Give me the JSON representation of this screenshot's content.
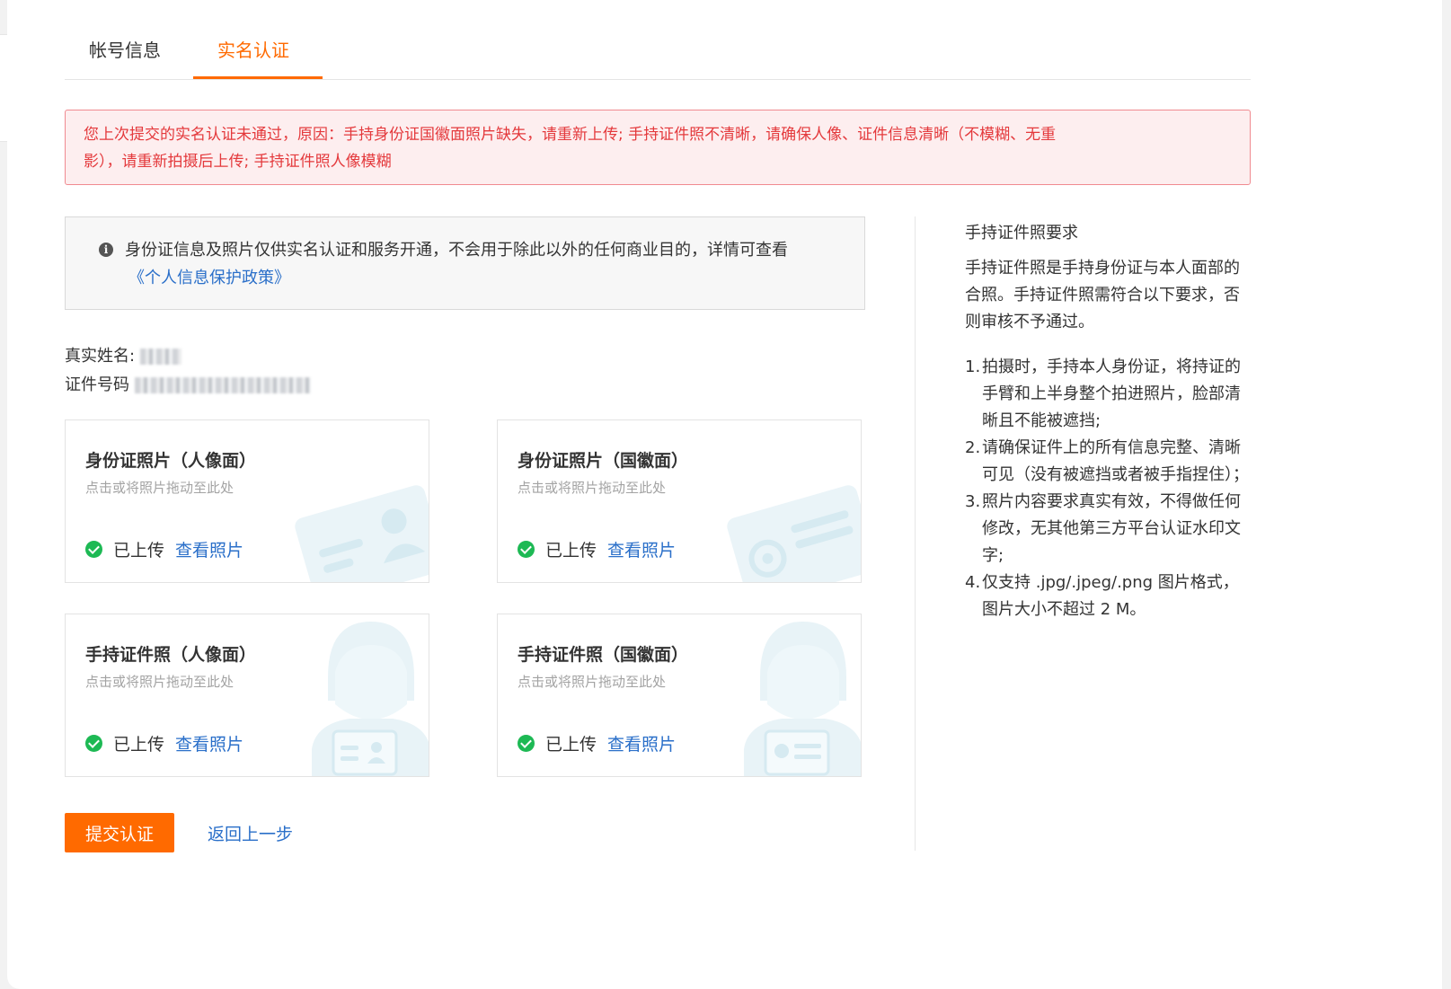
{
  "tabs": [
    {
      "label": "帐号信息",
      "active": false
    },
    {
      "label": "实名认证",
      "active": true
    }
  ],
  "error_banner": {
    "line1": "您上次提交的实名认证未通过，原因：手持身份证国徽面照片缺失，请重新上传; 手持证件照不清晰，请确保人像、证件信息清晰（不模糊、无重",
    "line2": "影），请重新拍摄后上传; 手持证件照人像模糊"
  },
  "info_box": {
    "icon": "info-circle-icon",
    "text": "身份证信息及照片仅供实名认证和服务开通，不会用于除此以外的任何商业目的，详情可查看",
    "link": "《个人信息保护政策》"
  },
  "identity": {
    "name_label": "真实姓名:",
    "id_label": "证件号码"
  },
  "cards": [
    {
      "title": "身份证照片（人像面）",
      "hint": "点击或将照片拖动至此处",
      "status": "已上传",
      "view": "查看照片",
      "illustration": "id-card-portrait-icon"
    },
    {
      "title": "身份证照片（国徽面）",
      "hint": "点击或将照片拖动至此处",
      "status": "已上传",
      "view": "查看照片",
      "illustration": "id-card-emblem-icon"
    },
    {
      "title": "手持证件照（人像面）",
      "hint": "点击或将照片拖动至此处",
      "status": "已上传",
      "view": "查看照片",
      "illustration": "person-holding-id-icon"
    },
    {
      "title": "手持证件照（国徽面）",
      "hint": "点击或将照片拖动至此处",
      "status": "已上传",
      "view": "查看照片",
      "illustration": "person-holding-id-icon"
    }
  ],
  "actions": {
    "submit": "提交认证",
    "back": "返回上一步"
  },
  "requirements": {
    "title": "手持证件照要求",
    "intro": "手持证件照是手持身份证与本人面部的合照。手持证件照需符合以下要求，否则审核不予通过。",
    "items": [
      {
        "num": "1.",
        "text": "拍摄时，手持本人身份证，将持证的手臂和上半身整个拍进照片，脸部清晰且不能被遮挡;"
      },
      {
        "num": "2.",
        "text": "请确保证件上的所有信息完整、清晰可见（没有被遮挡或者被手指捏住）；"
      },
      {
        "num": "3.",
        "text": "照片内容要求真实有效，不得做任何修改，无其他第三方平台认证水印文字;"
      },
      {
        "num": "4.",
        "text": "仅支持 .jpg/.jpeg/.png 图片格式，图片大小不超过 2 M。"
      }
    ]
  },
  "colors": {
    "accent": "#ff6a00",
    "link": "#2a6fc9",
    "error": "#e4393c",
    "success": "#1db954"
  }
}
